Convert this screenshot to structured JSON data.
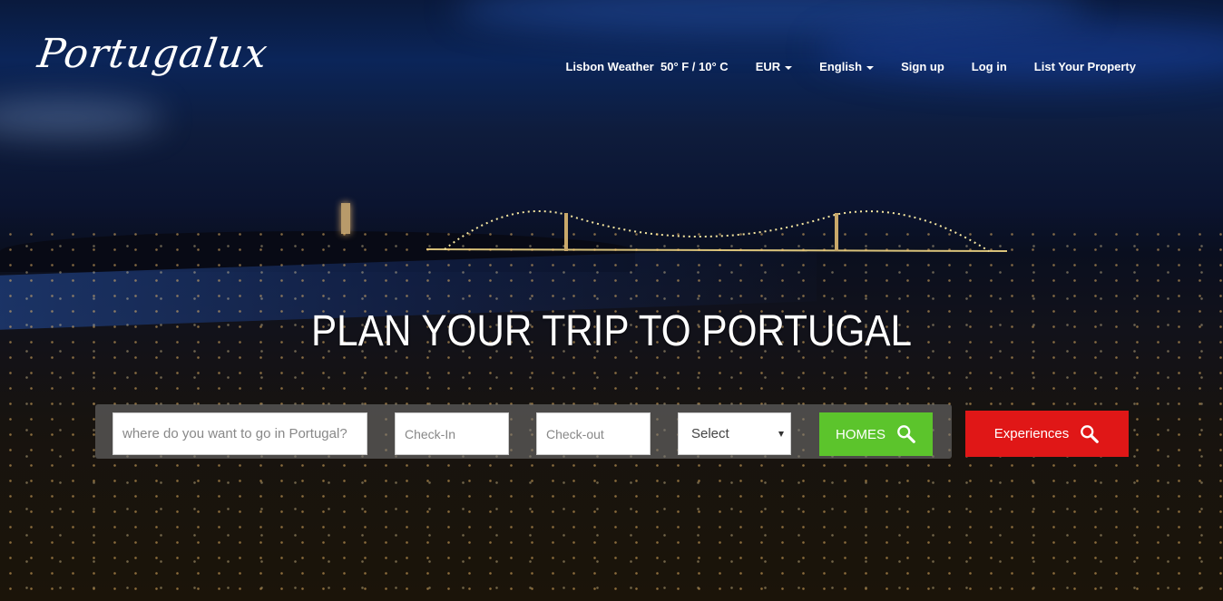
{
  "brand": {
    "logo_text": "Portugalux"
  },
  "nav": {
    "weather_label": "Lisbon Weather",
    "weather_value": "50° F / 10° C",
    "currency": "EUR",
    "language": "English",
    "signup": "Sign up",
    "login": "Log in",
    "list_property": "List Your Property"
  },
  "hero": {
    "headline": "PLAN YOUR TRIP TO PORTUGAL"
  },
  "search": {
    "destination_placeholder": "where do you want to go in Portugal?",
    "checkin_placeholder": "Check-In",
    "checkout_placeholder": "Check-out",
    "select_value": "Select",
    "homes_button": "HOMES",
    "experiences_button": "Experiences"
  },
  "colors": {
    "homes_green": "#5cc42c",
    "experiences_red": "#e01717"
  },
  "icons": [
    "caret-down-icon",
    "search-icon"
  ]
}
